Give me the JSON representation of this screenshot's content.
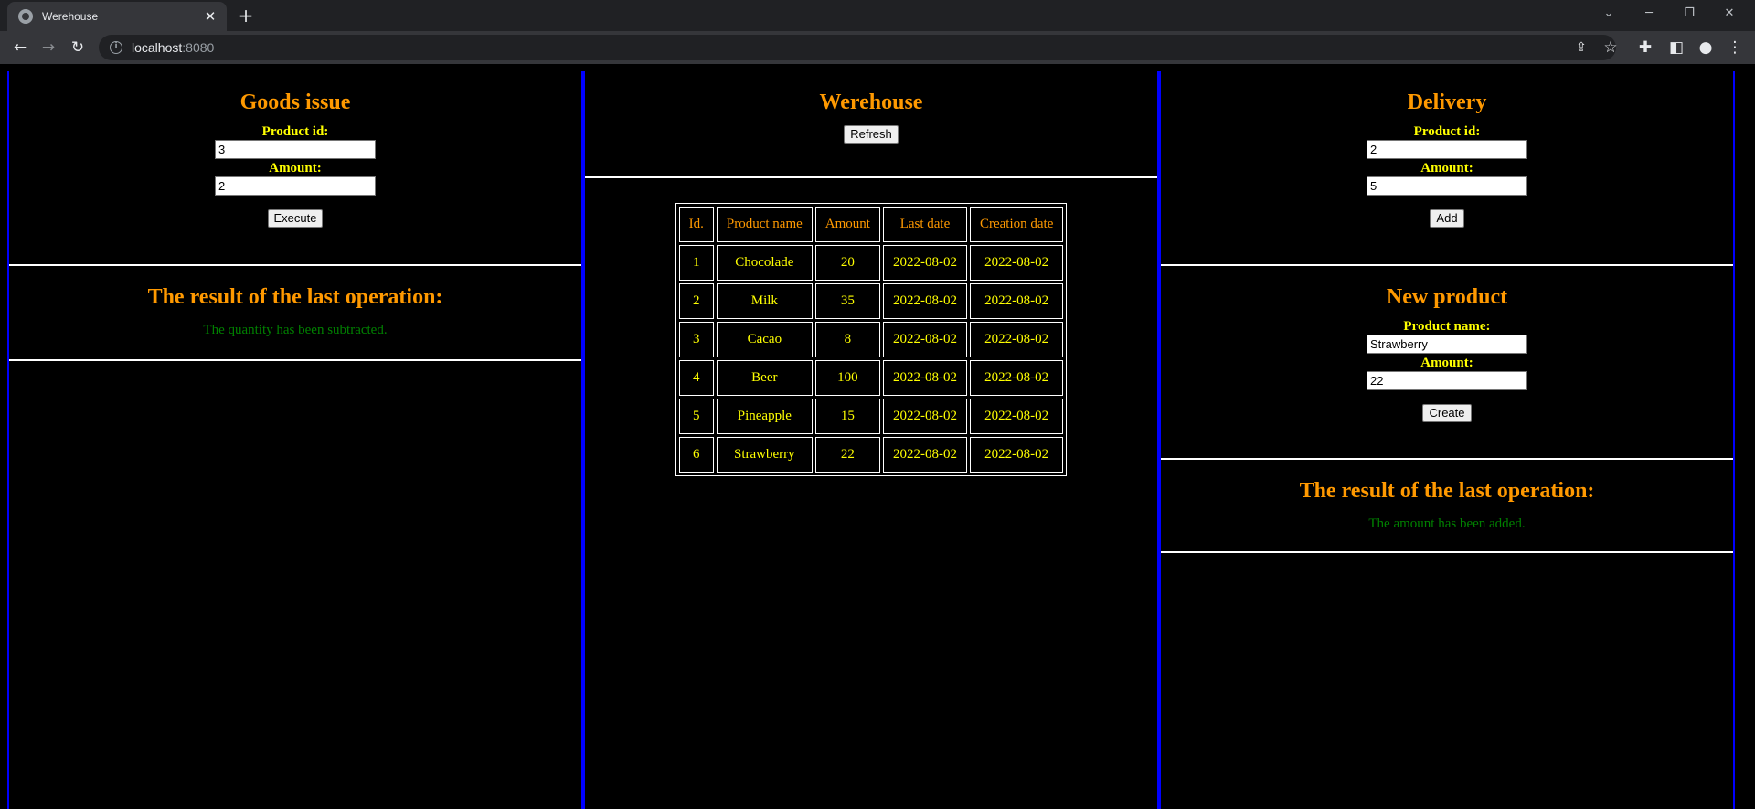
{
  "browser": {
    "tab_title": "Werehouse",
    "tab_close": "✕",
    "new_tab": "+",
    "url_host": "localhost",
    "url_port": ":8080"
  },
  "goods_issue": {
    "title": "Goods issue",
    "product_id_label": "Product id:",
    "product_id_value": "3",
    "amount_label": "Amount:",
    "amount_value": "2",
    "button": "Execute"
  },
  "left_result": {
    "title": "The result of the last operation:",
    "message": "The quantity has been subtracted."
  },
  "warehouse": {
    "title": "Werehouse",
    "refresh_button": "Refresh",
    "columns": [
      "Id.",
      "Product name",
      "Amount",
      "Last date",
      "Creation date"
    ],
    "rows": [
      [
        "1",
        "Chocolade",
        "20",
        "2022-08-02",
        "2022-08-02"
      ],
      [
        "2",
        "Milk",
        "35",
        "2022-08-02",
        "2022-08-02"
      ],
      [
        "3",
        "Cacao",
        "8",
        "2022-08-02",
        "2022-08-02"
      ],
      [
        "4",
        "Beer",
        "100",
        "2022-08-02",
        "2022-08-02"
      ],
      [
        "5",
        "Pineapple",
        "15",
        "2022-08-02",
        "2022-08-02"
      ],
      [
        "6",
        "Strawberry",
        "22",
        "2022-08-02",
        "2022-08-02"
      ]
    ]
  },
  "delivery": {
    "title": "Delivery",
    "product_id_label": "Product id:",
    "product_id_value": "2",
    "amount_label": "Amount:",
    "amount_value": "5",
    "button": "Add"
  },
  "new_product": {
    "title": "New product",
    "product_name_label": "Product name:",
    "product_name_value": "Strawberry",
    "amount_label": "Amount:",
    "amount_value": "22",
    "button": "Create"
  },
  "right_result": {
    "title": "The result of the last operation:",
    "message": "The amount has been added."
  },
  "colors": {
    "heading": "#ff9900",
    "label": "#ffff00",
    "success": "#008000",
    "column_border": "#0000ff",
    "background": "#000000"
  }
}
